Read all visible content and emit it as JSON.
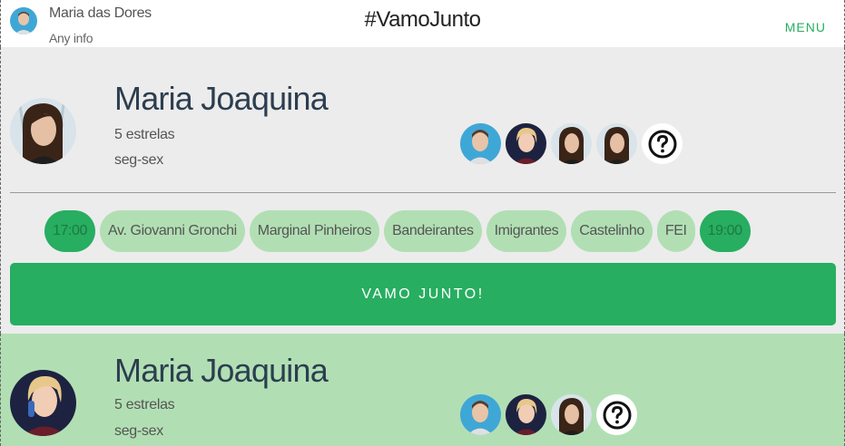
{
  "header": {
    "user_name": "Maria das Dores",
    "user_info": "Any info",
    "title": "#VamoJunto",
    "menu_label": "MENU"
  },
  "rides": [
    {
      "driver_name": "Maria Joaquina",
      "rating": "5 estrelas",
      "days": "seg-sex",
      "route": [
        "17:00",
        "Av. Giovanni Gronchi",
        "Marginal Pinheiros",
        "Bandeirantes",
        "Imigrantes",
        "Castelinho",
        "FEI",
        "19:00"
      ],
      "action_label": "VAMO JUNTO!"
    },
    {
      "driver_name": "Maria Joaquina",
      "rating": "5 estrelas",
      "days": "seg-sex"
    }
  ],
  "colors": {
    "accent": "#27ae60",
    "chip": "#b1dfb3",
    "background": "#ececec",
    "text": "#2c3e50"
  }
}
